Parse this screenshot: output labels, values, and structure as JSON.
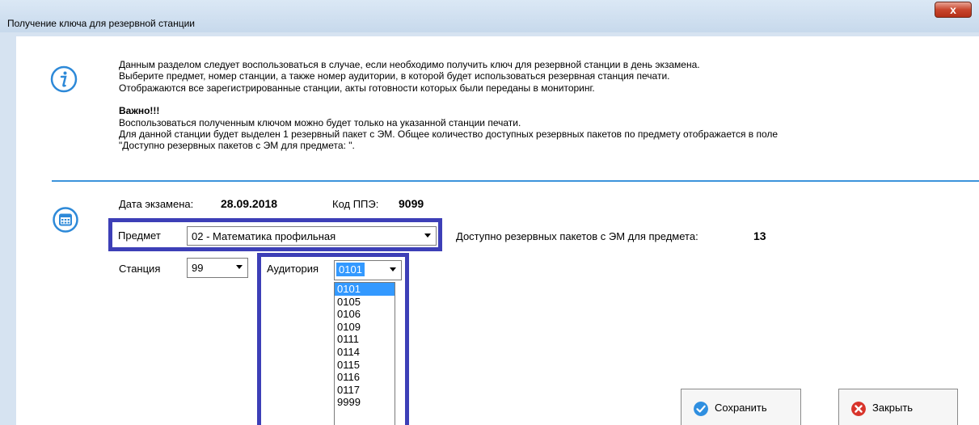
{
  "window": {
    "title": "Получение ключа для резервной станции",
    "close_label": "x"
  },
  "info": {
    "line1": "Данным разделом следует воспользоваться в случае, если необходимо получить ключ для резервной станции в день экзамена.",
    "line2": "Выберите предмет, номер станции, а также номер аудитории, в которой будет использоваться резервная станция печати.",
    "line3": "Отображаются все зарегистрированные станции, акты готовности которых были переданы в мониторинг.",
    "important": "Важно!!!",
    "line4": "Воспользоваться полученным ключом можно будет только на указанной станции печати.",
    "line5": "Для данной станции будет выделен 1 резервный пакет с ЭМ. Общее количество доступных резервных пакетов по предмету отображается в поле",
    "line6": "\"Доступно резервных пакетов с ЭМ для предмета: \"."
  },
  "form": {
    "exam_date_label": "Дата экзамена:",
    "exam_date": "28.09.2018",
    "ppe_label": "Код ППЭ:",
    "ppe_code": "9099",
    "subject_label": "Предмет",
    "subject_value": "02 - Математика профильная",
    "available_label": "Доступно резервных пакетов с ЭМ для предмета:",
    "available_count": "13",
    "station_label": "Станция",
    "station_value": "99",
    "room_label": "Аудитория",
    "room_value": "0101",
    "room_options": [
      "0101",
      "0105",
      "0106",
      "0109",
      "0111",
      "0114",
      "0115",
      "0116",
      "0117",
      "9999"
    ],
    "room_selected_index": 0
  },
  "buttons": {
    "save": "Сохранить",
    "close": "Закрыть"
  },
  "colors": {
    "highlight": "#3d3fb7",
    "accent": "#3c93db",
    "selection": "#3399ff"
  },
  "icons": [
    "info-icon",
    "calendar-icon",
    "check-icon",
    "close-x-icon",
    "chevron-down-icon"
  ]
}
